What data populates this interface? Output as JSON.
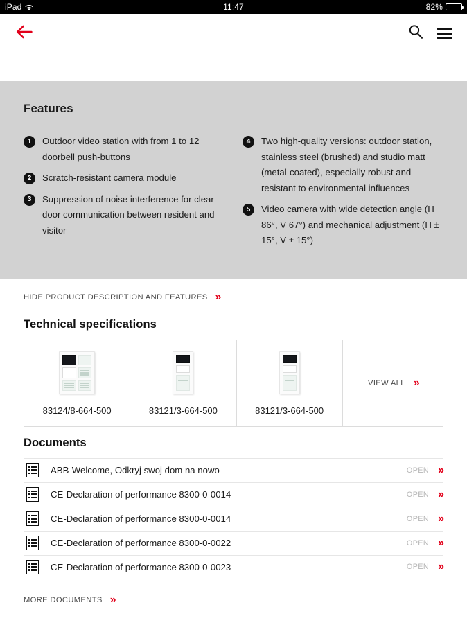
{
  "statusbar": {
    "device": "iPad",
    "wifi_icon": "wifi-icon",
    "time": "11:47",
    "battery_percent": "82%",
    "battery_icon": "battery-icon"
  },
  "navbar": {
    "back_icon": "back-arrow-icon",
    "search_icon": "search-icon",
    "menu_icon": "hamburger-menu-icon",
    "accent_color": "#e2001a"
  },
  "features": {
    "title": "Features",
    "background_color": "#d2d2d2",
    "left_items": [
      {
        "num": "1",
        "text": "Outdoor video station with from 1 to 12 doorbell push-buttons"
      },
      {
        "num": "2",
        "text": "Scratch-resistant camera module"
      },
      {
        "num": "3",
        "text": "Suppression of noise interference for clear door communication between resident and visitor"
      }
    ],
    "right_items": [
      {
        "num": "4",
        "text": "Two high-quality versions: outdoor station, stainless steel (brushed) and studio matt (metal-coated), especially robust and resistant to environmental influences"
      },
      {
        "num": "5",
        "text": "Video camera with wide detection angle (H 86°, V 67°) and mechanical adjustment (H ± 15°, V ± 15°)"
      }
    ]
  },
  "hide_link": {
    "label": "HIDE PRODUCT DESCRIPTION AND FEATURES",
    "chevron_icon": "double-chevron-right-icon",
    "chevron": "»"
  },
  "specs": {
    "title": "Technical specifications",
    "cards": [
      {
        "label": "83124/8-664-500",
        "image": "product-thumb-wide"
      },
      {
        "label": "83121/3-664-500",
        "image": "product-thumb-narrow"
      },
      {
        "label": "83121/3-664-500",
        "image": "product-thumb-narrow"
      }
    ],
    "view_all_label": "VIEW ALL",
    "view_all_chevron": "»"
  },
  "documents": {
    "title": "Documents",
    "open_label": "OPEN",
    "chevron": "»",
    "doc_icon": "document-icon",
    "rows": [
      {
        "name": "ABB-Welcome, Odkryj swoj dom na nowo"
      },
      {
        "name": "CE-Declaration of performance 8300-0-0014"
      },
      {
        "name": "CE-Declaration of performance 8300-0-0014"
      },
      {
        "name": "CE-Declaration of performance 8300-0-0022"
      },
      {
        "name": "CE-Declaration of performance 8300-0-0023"
      }
    ],
    "more_label": "MORE DOCUMENTS",
    "more_chevron": "»"
  }
}
